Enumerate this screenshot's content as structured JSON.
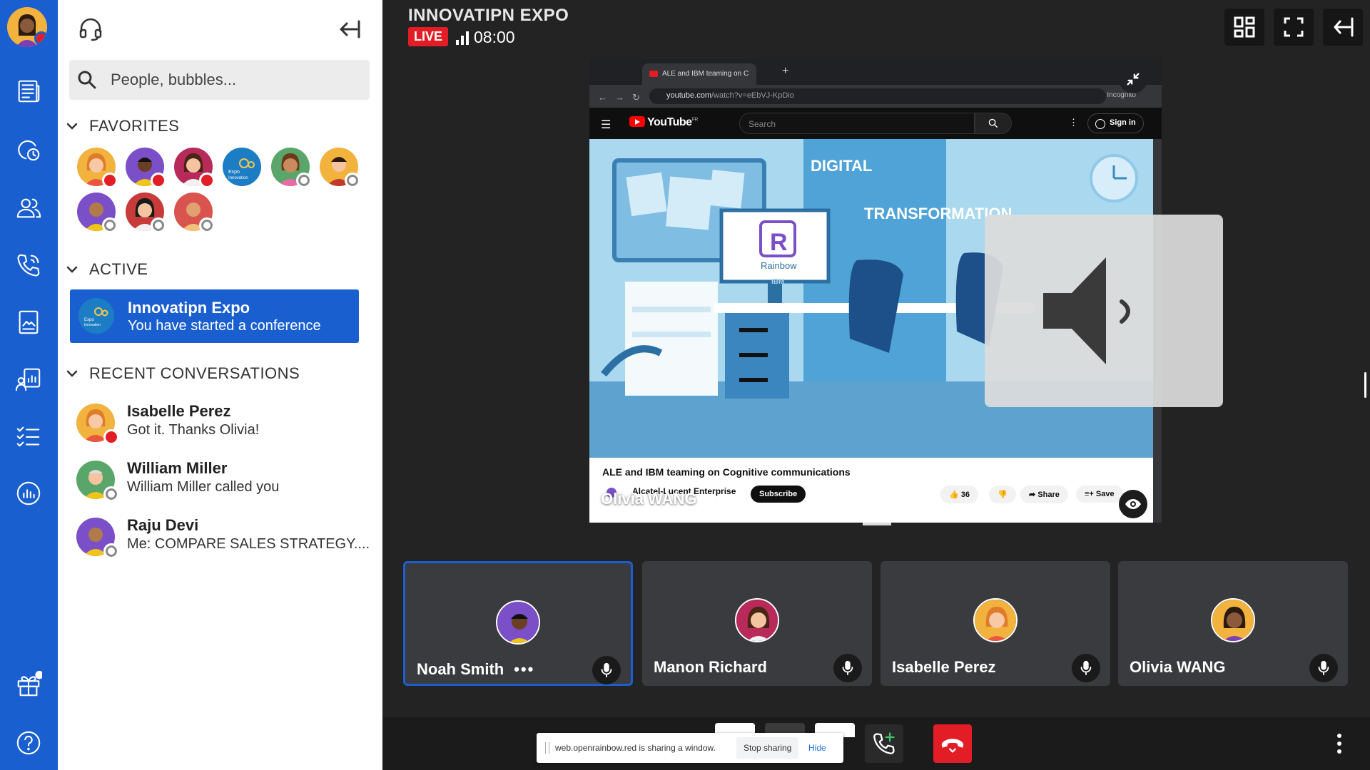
{
  "sidebar": {
    "search_placeholder": "People, bubbles...",
    "favorites_title": "FAVORITES",
    "active_title": "ACTIVE",
    "recent_title": "RECENT CONVERSATIONS",
    "favorites": [
      {
        "status": "busy"
      },
      {
        "status": "busy"
      },
      {
        "status": "busy"
      },
      {
        "status": "none",
        "logo": true
      },
      {
        "status": "offline"
      },
      {
        "status": "offline"
      },
      {
        "status": "offline"
      },
      {
        "status": "offline"
      },
      {
        "status": "offline"
      }
    ],
    "active_card": {
      "name": "Innovatipn Expo",
      "subtitle": "You have started a conference"
    },
    "recent": [
      {
        "name": "Isabelle Perez",
        "message": "Got it. Thanks Olivia!",
        "status": "busy"
      },
      {
        "name": "William Miller",
        "message": "William Miller called you",
        "status": "offline"
      },
      {
        "name": "Raju Devi",
        "message": "Me: COMPARE SALES STRATEGY....",
        "status": "offline"
      }
    ]
  },
  "conference": {
    "title": "INNOVATIPN EXPO",
    "live_label": "LIVE",
    "timer": "08:00"
  },
  "shared_screen": {
    "tab_title": "ALE and IBM teaming on C",
    "url_host": "youtube.com",
    "url_path": "/watch?v=eEbVJ-KpDio",
    "incognito_label": "Incognito",
    "yt_logo": "YouTube",
    "yt_region": "FR",
    "yt_search_placeholder": "Search",
    "sign_in": "Sign in",
    "video_title": "ALE and IBM teaming on Cognitive communications",
    "channel": "Alcatel-Lucent Enterprise",
    "subscribe": "Subscribe",
    "likes": "36",
    "share": "Share",
    "save": "Save",
    "scene_text_1": "DIGITAL",
    "scene_text_2": "TRANSFORMATION",
    "scene_brand": "Rainbow",
    "scene_ibm": "IBM",
    "presenter": "Olivia WANG"
  },
  "participants": [
    {
      "name": "Noah Smith",
      "selected": true,
      "more": "•••"
    },
    {
      "name": "Manon Richard",
      "selected": false
    },
    {
      "name": "Isabelle Perez",
      "selected": false
    },
    {
      "name": "Olivia WANG",
      "selected": false
    }
  ],
  "share_notice": {
    "text": "web.openrainbow.red is sharing a window.",
    "stop": "Stop sharing",
    "hide": "Hide"
  },
  "colors": {
    "brand_blue": "#1a5fd0",
    "live_red": "#e21d26",
    "hangup_red": "#e21d26"
  }
}
